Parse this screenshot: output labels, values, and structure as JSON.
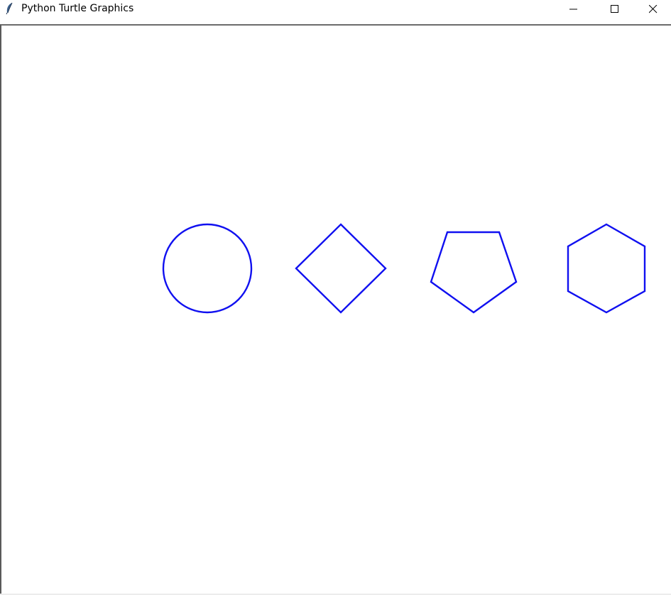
{
  "window": {
    "title": "Python Turtle Graphics",
    "buttons": {
      "minimize": "minimize",
      "maximize": "maximize",
      "close": "close"
    }
  },
  "canvas": {
    "pen_color": "#1010f0",
    "background": "#ffffff",
    "shapes": [
      "circle",
      "square",
      "pentagon",
      "hexagon"
    ]
  },
  "icons": {
    "app": "feather-icon",
    "minimize": "minimize-icon",
    "maximize": "maximize-icon",
    "close": "close-icon"
  }
}
